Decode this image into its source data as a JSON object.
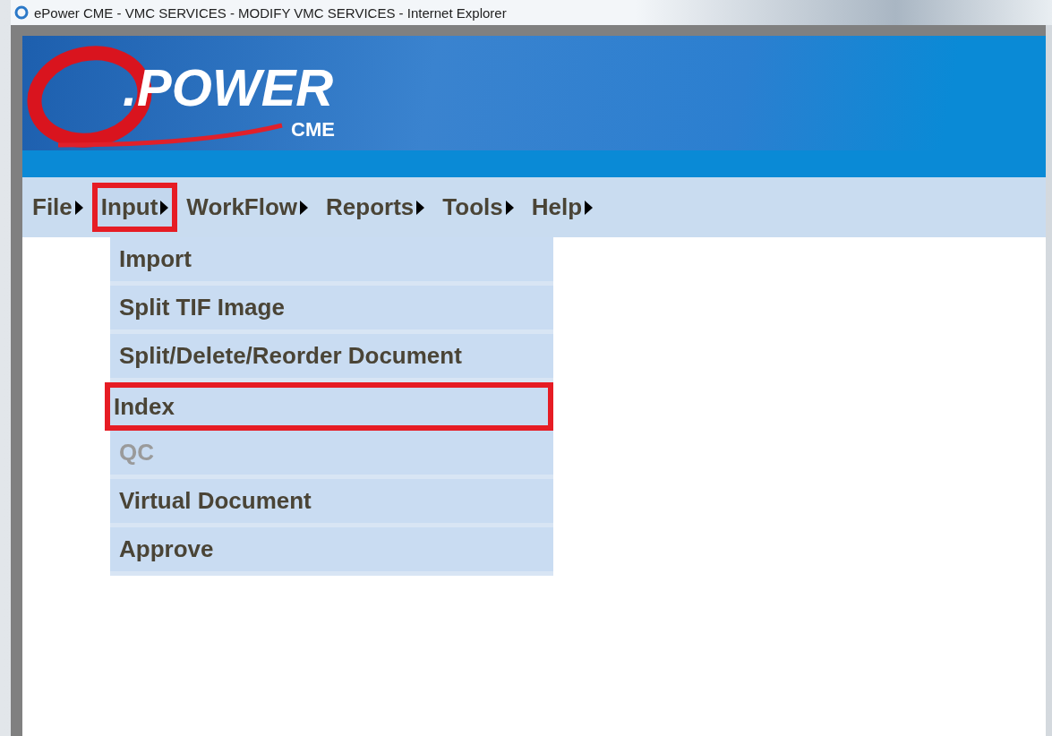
{
  "window": {
    "title": "ePower CME - VMC SERVICES - MODIFY VMC SERVICES - Internet Explorer"
  },
  "logo": {
    "wordmark": ".POWER",
    "suffix": "CME"
  },
  "menu": [
    {
      "label": "File",
      "highlighted": false
    },
    {
      "label": "Input",
      "highlighted": true
    },
    {
      "label": "WorkFlow",
      "highlighted": false
    },
    {
      "label": "Reports",
      "highlighted": false
    },
    {
      "label": "Tools",
      "highlighted": false
    },
    {
      "label": "Help",
      "highlighted": false
    }
  ],
  "dropdown": [
    {
      "label": "Import",
      "disabled": false,
      "highlighted": false
    },
    {
      "label": "Split TIF Image",
      "disabled": false,
      "highlighted": false
    },
    {
      "label": "Split/Delete/Reorder Document",
      "disabled": false,
      "highlighted": false
    },
    {
      "label": "Index",
      "disabled": false,
      "highlighted": true
    },
    {
      "label": "QC",
      "disabled": true,
      "highlighted": false
    },
    {
      "label": "Virtual Document",
      "disabled": false,
      "highlighted": false
    },
    {
      "label": "Approve",
      "disabled": false,
      "highlighted": false
    }
  ]
}
